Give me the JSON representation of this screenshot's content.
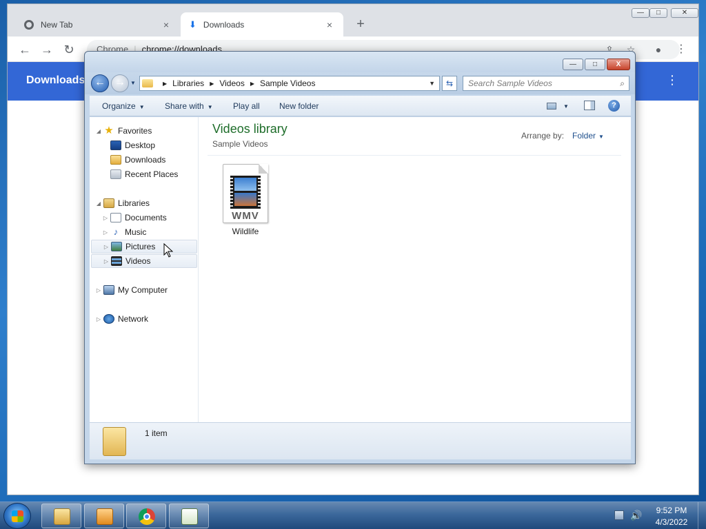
{
  "chrome": {
    "tabs": [
      {
        "title": "New Tab",
        "close": "×"
      },
      {
        "title": "Downloads",
        "close": "×"
      }
    ],
    "new_tab_label": "+",
    "window_controls": {
      "minimize": "—",
      "maximize": "□",
      "close": "✕"
    },
    "omnibox": {
      "site": "Chrome",
      "url": "chrome://downloads"
    },
    "page_header_title": "Downloads",
    "menu_glyph": "⋮"
  },
  "explorer": {
    "window_controls": {
      "minimize": "—",
      "maximize": "□",
      "close": "X"
    },
    "breadcrumb": [
      "Libraries",
      "Videos",
      "Sample Videos"
    ],
    "search_placeholder": "Search Sample Videos",
    "toolbar": {
      "organize": "Organize",
      "share_with": "Share with",
      "play_all": "Play all",
      "new_folder": "New folder",
      "help": "?"
    },
    "nav": {
      "favorites": {
        "label": "Favorites",
        "items": [
          "Desktop",
          "Downloads",
          "Recent Places"
        ]
      },
      "libraries": {
        "label": "Libraries",
        "items": [
          "Documents",
          "Music",
          "Pictures",
          "Videos"
        ]
      },
      "computer": "My Computer",
      "network": "Network"
    },
    "content": {
      "title": "Videos library",
      "subtitle": "Sample Videos",
      "arrange_label": "Arrange by:",
      "arrange_value": "Folder",
      "files": [
        {
          "name": "Wildlife",
          "type_badge": "WMV"
        }
      ]
    },
    "details": {
      "count": "1 item"
    }
  },
  "taskbar": {
    "time": "9:52 PM",
    "date": "4/3/2022",
    "pinned": [
      "explorer-icon",
      "media-player-icon",
      "chrome-icon",
      "app-icon"
    ]
  }
}
